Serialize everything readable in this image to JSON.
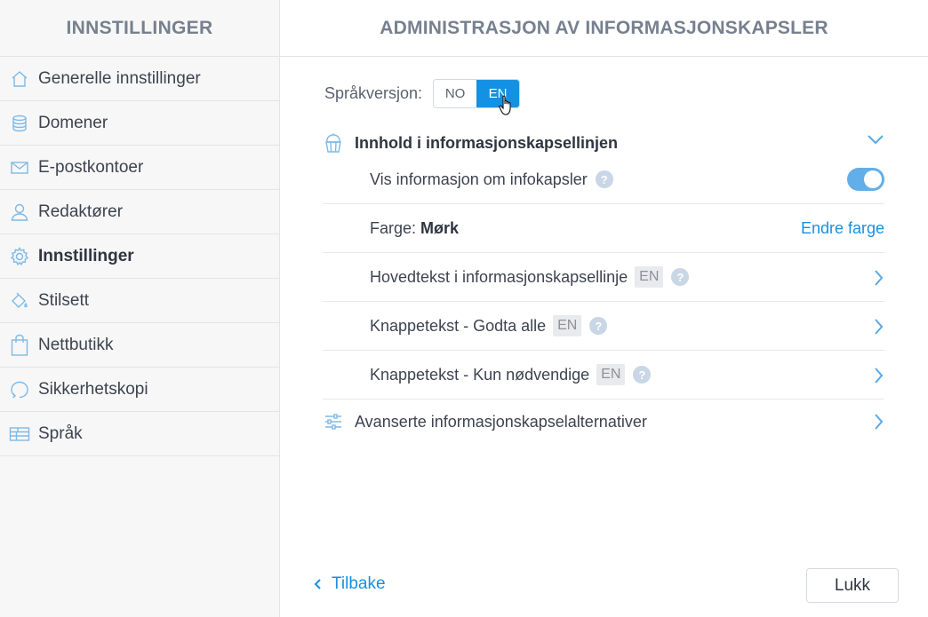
{
  "sidebar": {
    "title": "INNSTILLINGER",
    "items": [
      {
        "label": "Generelle innstillinger",
        "icon": "home-icon"
      },
      {
        "label": "Domener",
        "icon": "database-icon"
      },
      {
        "label": "E-postkontoer",
        "icon": "envelope-icon"
      },
      {
        "label": "Redaktører",
        "icon": "user-icon"
      },
      {
        "label": "Innstillinger",
        "icon": "gear-icon",
        "active": true
      },
      {
        "label": "Stilsett",
        "icon": "paint-bucket-icon"
      },
      {
        "label": "Nettbutikk",
        "icon": "shopping-bag-icon"
      },
      {
        "label": "Sikkerhetskopi",
        "icon": "backup-icon"
      },
      {
        "label": "Språk",
        "icon": "language-icon"
      }
    ]
  },
  "main": {
    "title": "ADMINISTRASJON AV INFORMASJONSKAPSLER",
    "language": {
      "label": "Språkversjon:",
      "options": [
        "NO",
        "EN"
      ],
      "selected": "EN"
    },
    "section": {
      "title": "Innhold i informasjonskapsellinjen",
      "rows": {
        "show_info": {
          "label": "Vis informasjon om infokapsler",
          "help": "?",
          "enabled": true
        },
        "color": {
          "label": "Farge:",
          "value": "Mørk",
          "action": "Endre farge"
        },
        "main_text": {
          "label": "Hovedtekst i informasjonskapsellinje",
          "tag": "EN",
          "help": "?"
        },
        "accept_all": {
          "label": "Knappetekst - Godta alle",
          "tag": "EN",
          "help": "?"
        },
        "necessary": {
          "label": "Knappetekst - Kun nødvendige",
          "tag": "EN",
          "help": "?"
        }
      }
    },
    "advanced": {
      "label": "Avanserte informasjonskapselalternativer"
    },
    "footer": {
      "back_label": "Tilbake",
      "close_label": "Lukk"
    }
  },
  "colors": {
    "accent": "#1591e3",
    "toggle_on": "#62aee9",
    "header_text": "#77808f"
  }
}
